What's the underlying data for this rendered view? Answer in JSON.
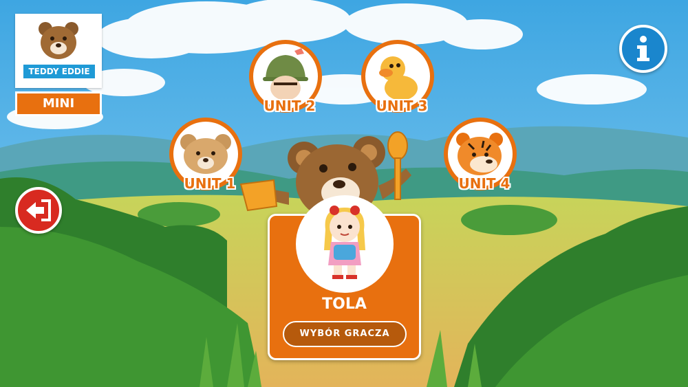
{
  "logo": {
    "brand": "TEDDY EDDIE"
  },
  "mode_button": {
    "label": "MINI"
  },
  "units": [
    {
      "label": "UNIT 1",
      "icon": "teddy-bear-icon"
    },
    {
      "label": "UNIT 2",
      "icon": "soldier-boy-icon"
    },
    {
      "label": "UNIT 3",
      "icon": "duck-icon"
    },
    {
      "label": "UNIT 4",
      "icon": "tiger-icon"
    }
  ],
  "player": {
    "name": "TOLA",
    "select_label": "WYBÓR GRACZA",
    "avatar": "doll-icon"
  },
  "colors": {
    "accent": "#e8700f",
    "info": "#1a86cd",
    "back": "#d82a20",
    "sky": "#5fb9ea",
    "grass": "#a9c43a"
  }
}
